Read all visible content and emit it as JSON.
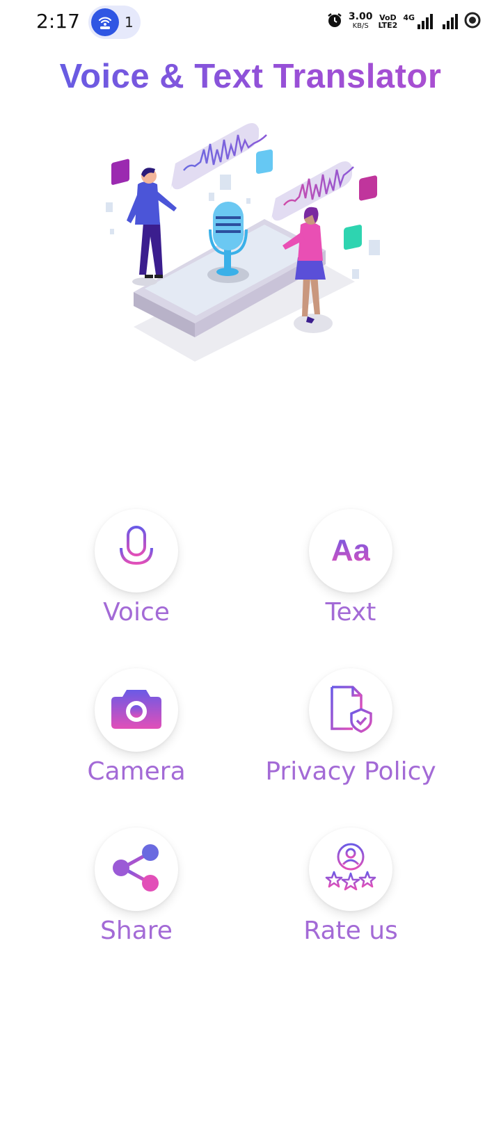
{
  "status_bar": {
    "time": "2:17",
    "hotspot_count": "1",
    "net_speed_value": "3.00",
    "net_speed_unit": "KB/S",
    "volte_line1": "VoD",
    "volte_line2": "LTE2",
    "network_type": "4G"
  },
  "header": {
    "title": "Voice & Text Translator"
  },
  "menu": {
    "voice": "Voice",
    "text": "Text",
    "text_icon_glyph": "Aa",
    "camera": "Camera",
    "privacy": "Privacy Policy",
    "share": "Share",
    "rate": "Rate us"
  },
  "colors": {
    "title_gradient_start": "#5b5fe6",
    "title_gradient_end": "#b04fcf",
    "label_color": "#a36ad6",
    "icon_gradient_start": "#6a5ae6",
    "icon_gradient_end": "#e24fb8"
  }
}
